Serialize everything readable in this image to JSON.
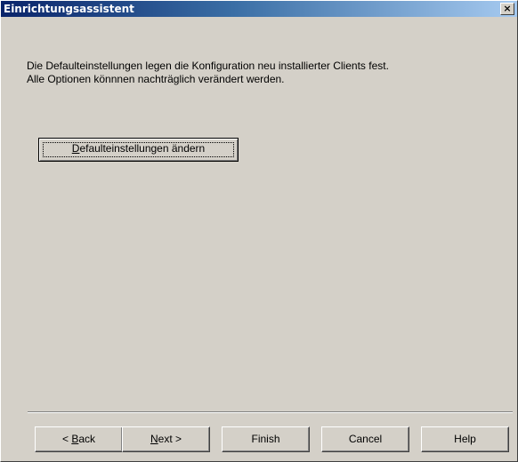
{
  "window": {
    "title": "Einrichtungsassistent",
    "close_glyph": "×"
  },
  "content": {
    "description_line1": "Die Defaulteinstellungen legen die Konfiguration neu installierter Clients fest.",
    "description_line2": "Alle Optionen könnnen nachträglich verändert werden.",
    "defaults_button": {
      "mnemonic": "D",
      "rest": "efaulteinstellungen ändern"
    }
  },
  "footer": {
    "back": {
      "arrow": "< ",
      "mnemonic": "B",
      "rest": "ack"
    },
    "next": {
      "mnemonic": "N",
      "rest": "ext",
      "arrow": " >"
    },
    "finish": "Finish",
    "cancel": "Cancel",
    "help": "Help"
  },
  "colors": {
    "dialog_background": "#d4d0c8",
    "titlebar_start": "#0a246a",
    "titlebar_end": "#a6caf0",
    "title_text": "#ffffff"
  }
}
